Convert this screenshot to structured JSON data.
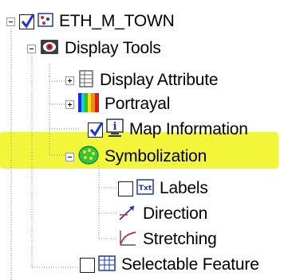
{
  "tree": {
    "root": {
      "label": "ETH_M_TOWN",
      "checked": true,
      "icon": "layer-icon"
    },
    "display_tools": {
      "label": "Display Tools",
      "icon": "display-tools-icon"
    },
    "display_attribute": {
      "label": "Display Attribute",
      "icon": "table-icon"
    },
    "portrayal": {
      "label": "Portrayal",
      "icon": "color-bars-icon"
    },
    "map_information": {
      "label": "Map Information",
      "checked": true,
      "icon": "info-icon"
    },
    "symbolization": {
      "label": "Symbolization",
      "icon": "symbol-palette-icon",
      "highlighted": true,
      "highlight_color": "#f3f53a"
    },
    "labels": {
      "label": "Labels",
      "checked": false,
      "icon": "text-label-icon"
    },
    "direction": {
      "label": "Direction",
      "icon": "arrow-direction-icon"
    },
    "stretching": {
      "label": "Stretching",
      "icon": "stretch-curve-icon"
    },
    "selectable_features": {
      "label": "Selectable Feature",
      "checked": false,
      "icon": "grid-table-icon"
    }
  }
}
